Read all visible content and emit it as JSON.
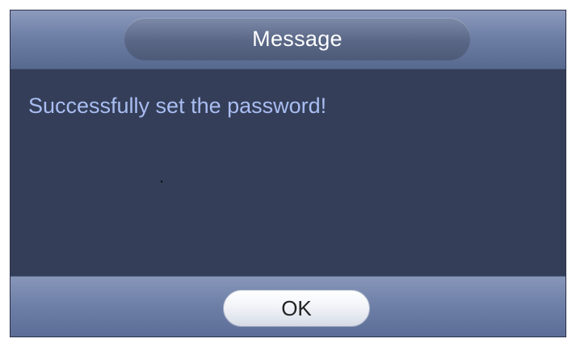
{
  "dialog": {
    "title": "Message",
    "message": "Successfully set  the password!",
    "ok_label": "OK"
  },
  "colors": {
    "background": "#333e58",
    "message_text": "#a9bdf2",
    "title_text": "#ffffff",
    "ok_text": "#222222"
  }
}
